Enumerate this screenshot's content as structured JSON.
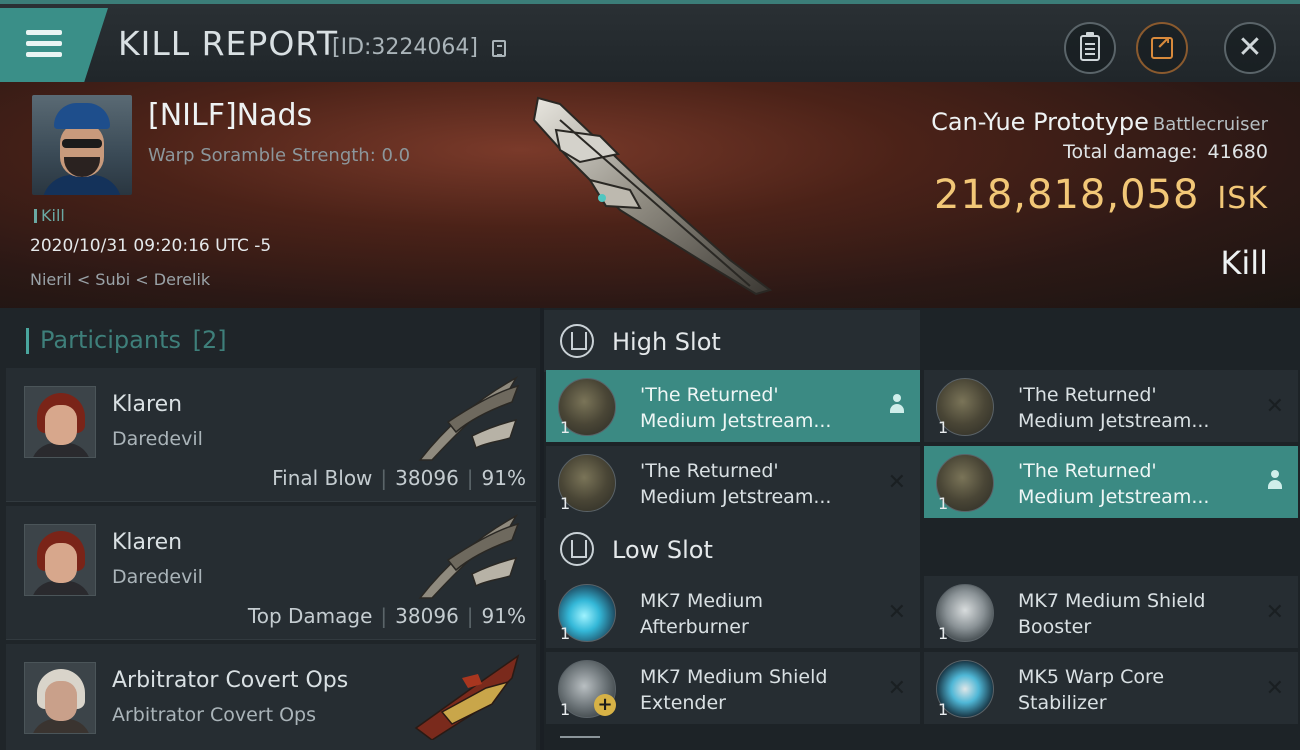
{
  "header": {
    "title": "KILL REPORT",
    "report_id": "[ID:3224064]",
    "icons": [
      "menu-icon",
      "copy-icon",
      "clipboard-icon",
      "share-icon",
      "close-icon"
    ]
  },
  "victim": {
    "name": "[NILF]Nads",
    "warp_scramble": "Warp Soramble Strength: 0.0",
    "tag": "Kill",
    "timestamp": "2020/10/31 09:20:16 UTC -5",
    "location": "Nieril < Subi < Derelik",
    "ship_name": "Can-Yue Prototype",
    "ship_class": "Battlecruiser",
    "total_damage_label": "Total damage:",
    "total_damage_value": "41680",
    "isk_value": "218,818,058",
    "isk_unit": "ISK",
    "result": "Kill"
  },
  "participants": {
    "header": "Participants",
    "count": "[2]",
    "rows": [
      {
        "name": "Klaren",
        "ship": "Daredevil",
        "role": "Final Blow",
        "damage": "38096",
        "percent": "91%"
      },
      {
        "name": "Klaren",
        "ship": "Daredevil",
        "role": "Top Damage",
        "damage": "38096",
        "percent": "91%"
      },
      {
        "name": "Arbitrator Covert Ops",
        "ship": "Arbitrator Covert Ops"
      }
    ]
  },
  "fitting": {
    "high_slot_title": "High Slot",
    "low_slot_title": "Low Slot",
    "high": [
      {
        "line1": "'The Returned'",
        "line2": "Medium Jetstream...",
        "qty": "1",
        "state": "active-person"
      },
      {
        "line1": "'The Returned'",
        "line2": "Medium Jetstream...",
        "qty": "1",
        "state": "x"
      },
      {
        "line1": "'The Returned'",
        "line2": "Medium Jetstream...",
        "qty": "1",
        "state": "x"
      },
      {
        "line1": "'The Returned'",
        "line2": "Medium Jetstream...",
        "qty": "1",
        "state": "active-person"
      }
    ],
    "low": [
      {
        "line1": "MK7 Medium",
        "line2": "Afterburner",
        "qty": "1",
        "icon": "afterburner-icon"
      },
      {
        "line1": "MK7 Medium Shield",
        "line2": "Booster",
        "qty": "1",
        "icon": "shield-booster-icon"
      },
      {
        "line1": "MK7 Medium Shield",
        "line2": "Extender",
        "qty": "1",
        "icon": "shield-extender-icon"
      },
      {
        "line1": "MK5 Warp Core",
        "line2": "Stabilizer",
        "qty": "1",
        "icon": "warp-core-stabilizer-icon"
      }
    ]
  },
  "colors": {
    "accent_teal": "#3b8a83",
    "isk_gold": "#f2c777",
    "share_orange": "#d88a3c"
  }
}
